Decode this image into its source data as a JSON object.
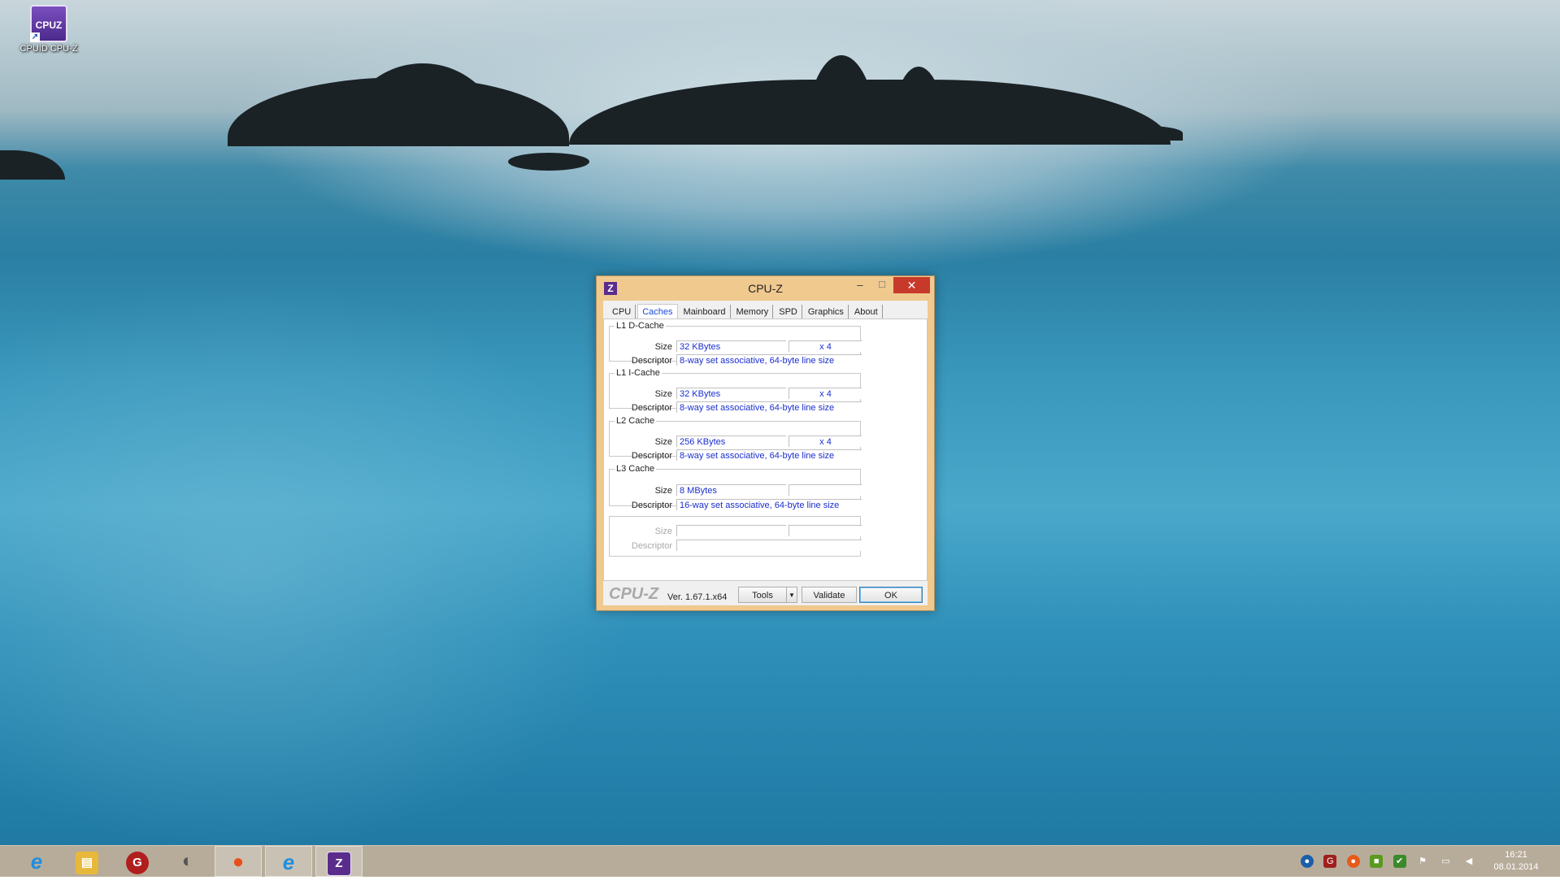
{
  "desktop": {
    "icon_label": "CPUID CPU-Z",
    "icon_glyph": "CPUZ"
  },
  "window": {
    "title": "CPU-Z",
    "app_icon_glyph": "Z",
    "minimize_glyph": "–",
    "maximize_glyph": "☐",
    "close_glyph": "✕",
    "tabs": [
      "CPU",
      "Caches",
      "Mainboard",
      "Memory",
      "SPD",
      "Graphics",
      "About"
    ],
    "active_tab": "Caches",
    "groups": [
      {
        "title": "L1 D-Cache",
        "size_label": "Size",
        "size": "32 KBytes",
        "multiplier": "x 4",
        "desc_label": "Descriptor",
        "descriptor": "8-way set associative, 64-byte line size"
      },
      {
        "title": "L1 I-Cache",
        "size_label": "Size",
        "size": "32 KBytes",
        "multiplier": "x 4",
        "desc_label": "Descriptor",
        "descriptor": "8-way set associative, 64-byte line size"
      },
      {
        "title": "L2 Cache",
        "size_label": "Size",
        "size": "256 KBytes",
        "multiplier": "x 4",
        "desc_label": "Descriptor",
        "descriptor": "8-way set associative, 64-byte line size"
      },
      {
        "title": "L3 Cache",
        "size_label": "Size",
        "size": "8 MBytes",
        "multiplier": "",
        "desc_label": "Descriptor",
        "descriptor": "16-way set associative, 64-byte line size"
      },
      {
        "title": "",
        "size_label": "Size",
        "size": "",
        "multiplier": "",
        "desc_label": "Descriptor",
        "descriptor": ""
      }
    ],
    "footer": {
      "logo": "CPU-Z",
      "version": "Ver. 1.67.1.x64",
      "tools_label": "Tools",
      "tools_dropdown_glyph": "▼",
      "validate_label": "Validate",
      "ok_label": "OK"
    }
  },
  "taskbar": {
    "items": [
      {
        "name": "internet-explorer",
        "glyph": "e",
        "color": "#1e8fe0"
      },
      {
        "name": "file-explorer",
        "glyph": "▤",
        "color": "#e8b83a"
      },
      {
        "name": "gpu-tweak",
        "glyph": "G",
        "color": "#b01e1e"
      },
      {
        "name": "speaker-app",
        "glyph": "◐",
        "color": "#6a6a6a"
      },
      {
        "name": "orange-app",
        "glyph": "●",
        "color": "#e8501a"
      },
      {
        "name": "internet-explorer-2",
        "glyph": "e",
        "color": "#1e8fe0"
      },
      {
        "name": "cpu-z",
        "glyph": "Z",
        "color": "#5a2d8c"
      }
    ],
    "tray": [
      {
        "name": "globe",
        "glyph": "●",
        "color": "#1c5fa8"
      },
      {
        "name": "gpu-tweak-tray",
        "glyph": "G",
        "color": "#a01e1e"
      },
      {
        "name": "orange-tray",
        "glyph": "●",
        "color": "#e85a1a"
      },
      {
        "name": "nvidia-tray",
        "glyph": "■",
        "color": "#5a9a1e"
      },
      {
        "name": "shield-tray",
        "glyph": "✔",
        "color": "#3a8a2a"
      },
      {
        "name": "flag-tray",
        "glyph": "⚑",
        "color": "#4a4a4a"
      },
      {
        "name": "network-tray",
        "glyph": "▭",
        "color": "#4a4a4a"
      },
      {
        "name": "volume-tray",
        "glyph": "◀",
        "color": "#4a4a4a"
      }
    ],
    "time": "16:21",
    "date": "08.01.2014"
  }
}
